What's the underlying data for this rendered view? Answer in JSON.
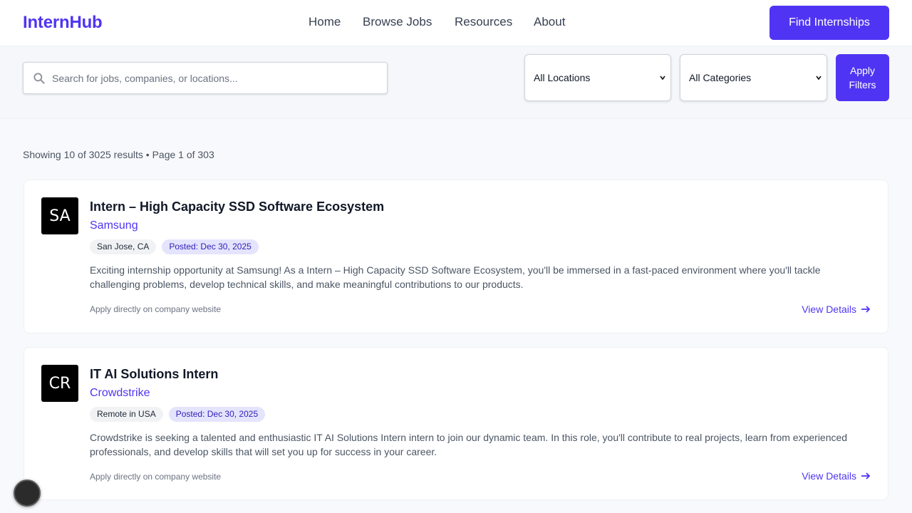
{
  "brand": {
    "name": "InternHub",
    "accent": "#4f35f3"
  },
  "nav": {
    "home": "Home",
    "browse": "Browse Jobs",
    "resources": "Resources",
    "about": "About",
    "cta": "Find Internships"
  },
  "filters": {
    "search_placeholder": "Search for jobs, companies, or locations...",
    "search_value": "",
    "location_selected": "All Locations",
    "category_selected": "All Categories",
    "apply_label": "Apply Filters"
  },
  "results_summary": "Showing 10 of 3025 results • Page 1 of 303",
  "jobs": [
    {
      "initials": "SA",
      "title": "Intern – High Capacity SSD Software Ecosystem",
      "company": "Samsung",
      "location": "San Jose, CA",
      "posted": "Posted: Dec 30, 2025",
      "description": "Exciting internship opportunity at Samsung! As a Intern – High Capacity SSD Software Ecosystem, you'll be immersed in a fast-paced environment where you'll tackle challenging problems, develop technical skills, and make meaningful contributions to our products.",
      "apply_note": "Apply directly on company website",
      "details_label": "View Details"
    },
    {
      "initials": "CR",
      "title": "IT AI Solutions Intern",
      "company": "Crowdstrike",
      "location": "Remote in USA",
      "posted": "Posted: Dec 30, 2025",
      "description": "Crowdstrike is seeking a talented and enthusiastic IT AI Solutions Intern intern to join our dynamic team. In this role, you'll contribute to real projects, learn from experienced professionals, and develop skills that will set you up for success in your career.",
      "apply_note": "Apply directly on company website",
      "details_label": "View Details"
    }
  ],
  "icons": {
    "search": "search-icon",
    "chevron": "chevron-down-icon",
    "arrow": "arrow-right-icon"
  }
}
